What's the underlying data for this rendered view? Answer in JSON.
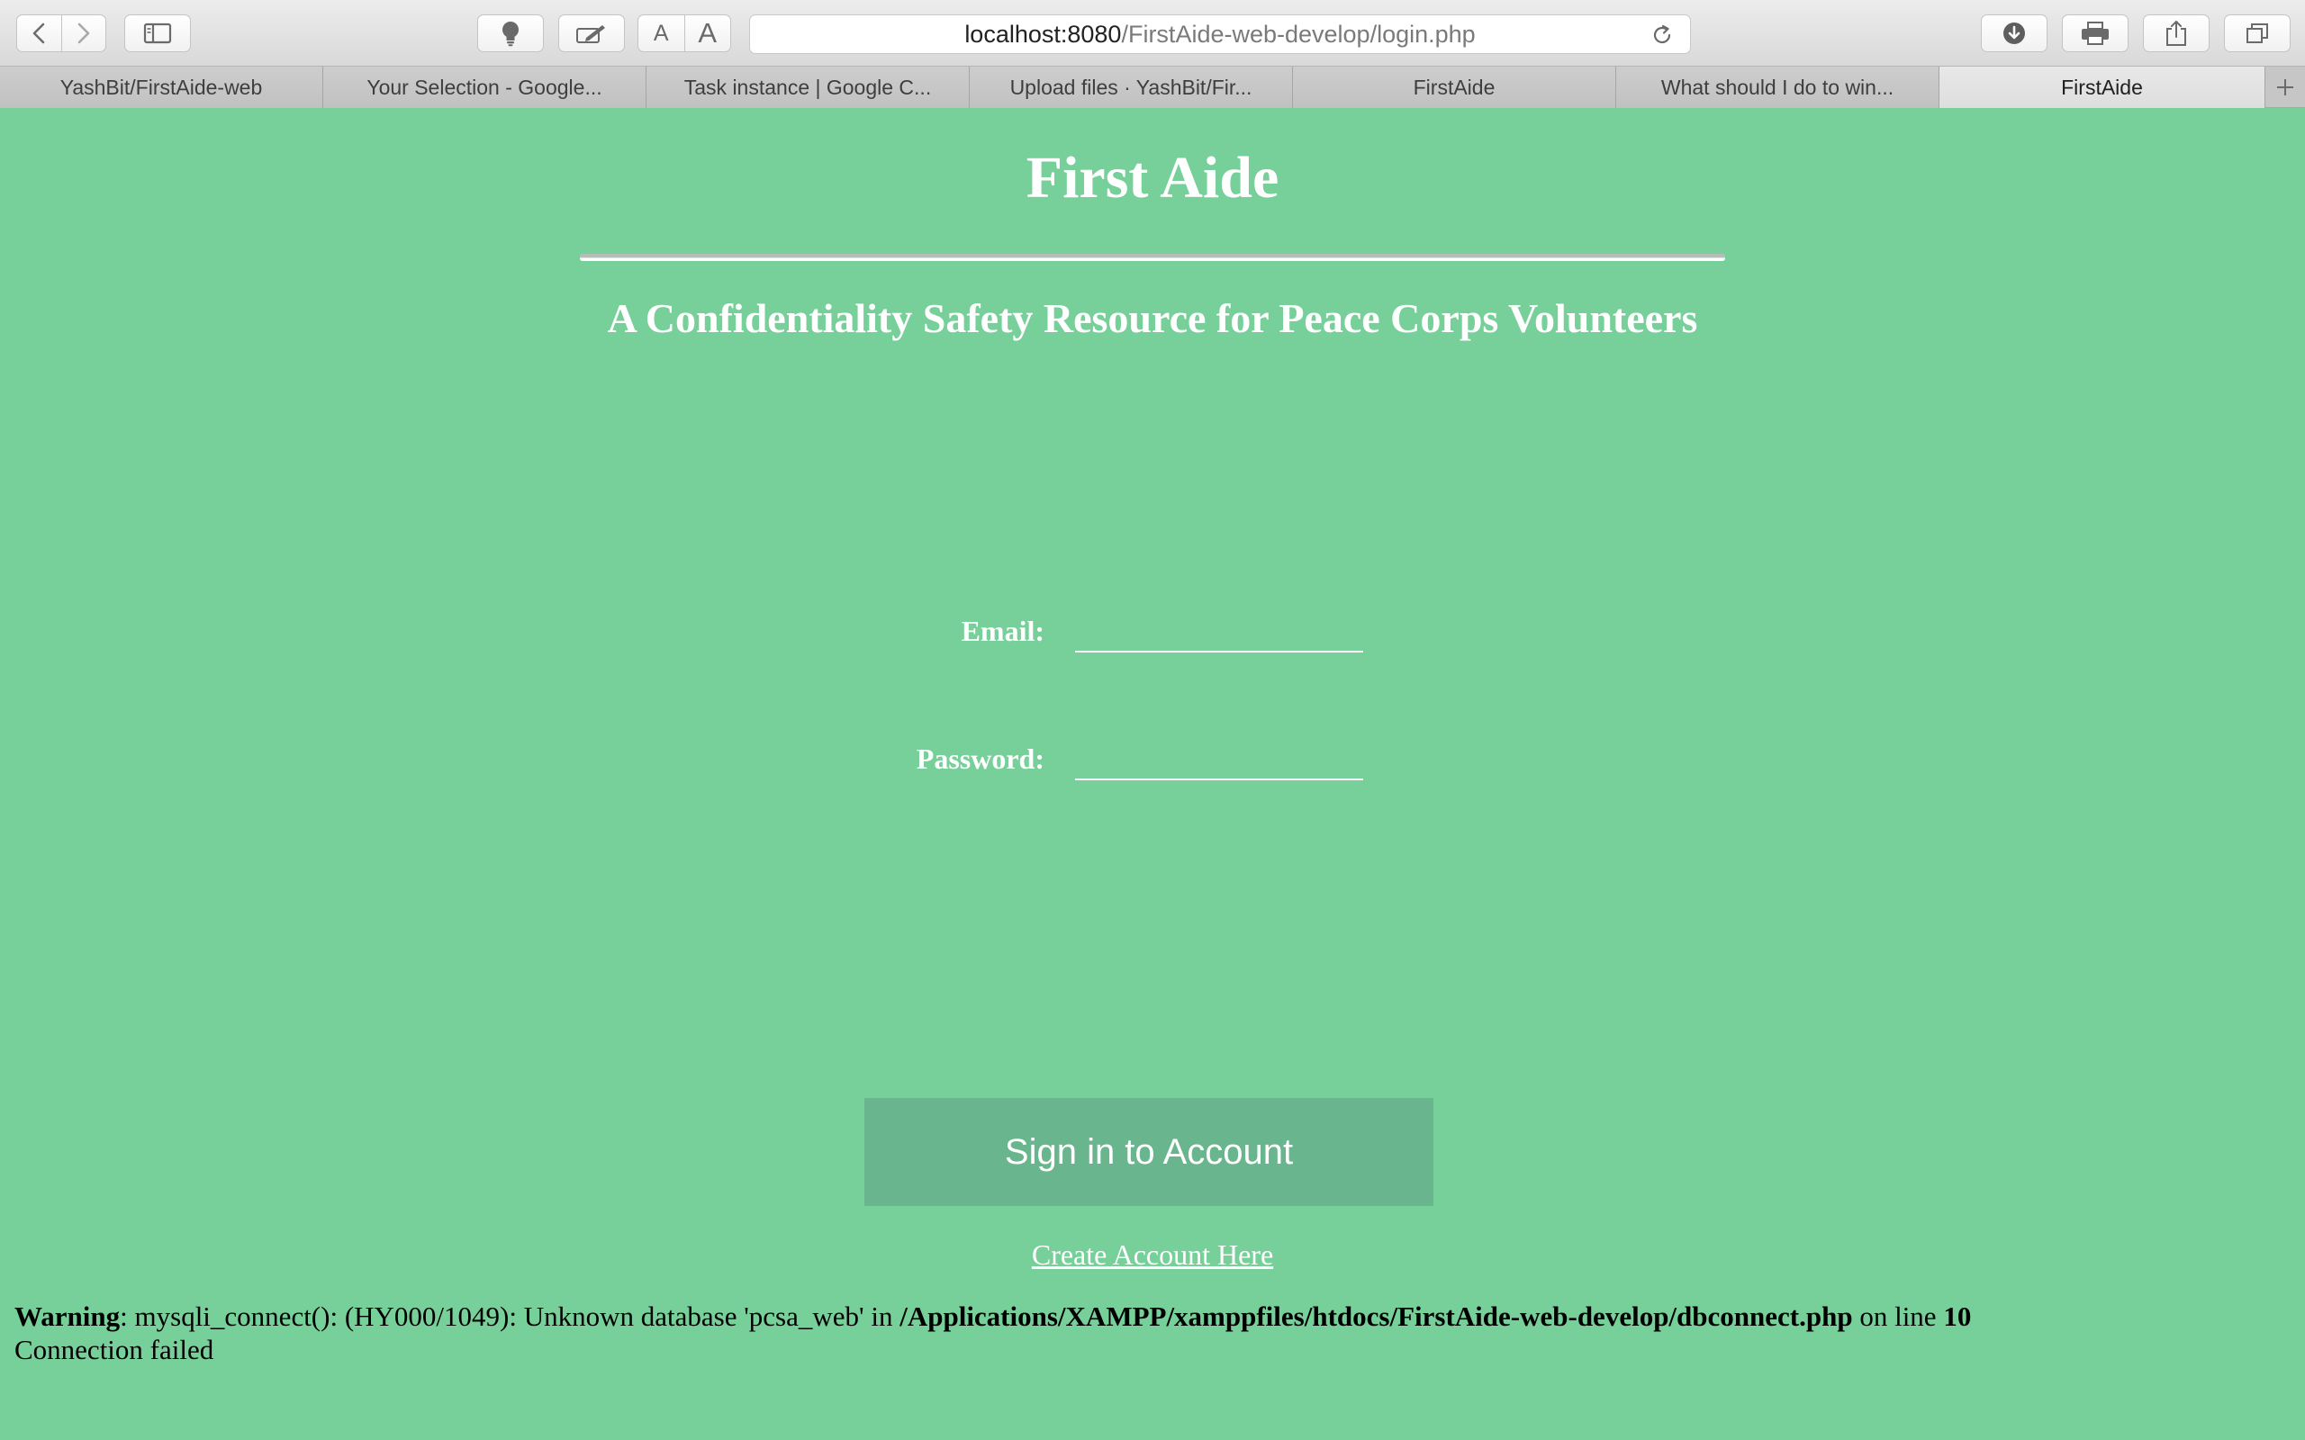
{
  "browser": {
    "address": {
      "host": "localhost:8080",
      "path": "/FirstAide-web-develop/login.php"
    },
    "font_small": "A",
    "font_large": "A",
    "tabs": [
      {
        "label": "YashBit/FirstAide-web"
      },
      {
        "label": "Your Selection - Google..."
      },
      {
        "label": "Task instance | Google C..."
      },
      {
        "label": "Upload files · YashBit/Fir..."
      },
      {
        "label": "FirstAide"
      },
      {
        "label": "What should I do to win..."
      },
      {
        "label": "FirstAide",
        "active": true
      }
    ],
    "icons": [
      "back-icon",
      "forward-icon",
      "sidebar-icon",
      "lightbulb-icon",
      "annotate-icon",
      "reload-icon",
      "download-icon",
      "print-icon",
      "share-icon",
      "tabs-overview-icon",
      "plus-icon"
    ]
  },
  "page": {
    "title": "First Aide",
    "subtitle": "A Confidentiality Safety Resource for Peace Corps Volunteers",
    "email_label": "Email:",
    "email_value": "",
    "password_label": "Password:",
    "password_value": "",
    "signin_button": "Sign in to Account",
    "create_link": "Create Account Here",
    "background_color": "#77d099",
    "button_color": "#69b58e"
  },
  "warning": {
    "label": "Warning",
    "message": ": mysqli_connect(): (HY000/1049): Unknown database 'pcsa_web' in ",
    "file": "/Applications/XAMPP/xamppfiles/htdocs/FirstAide-web-develop/dbconnect.php",
    "on_line_text": " on line ",
    "line": "10",
    "status": "Connection failed"
  }
}
